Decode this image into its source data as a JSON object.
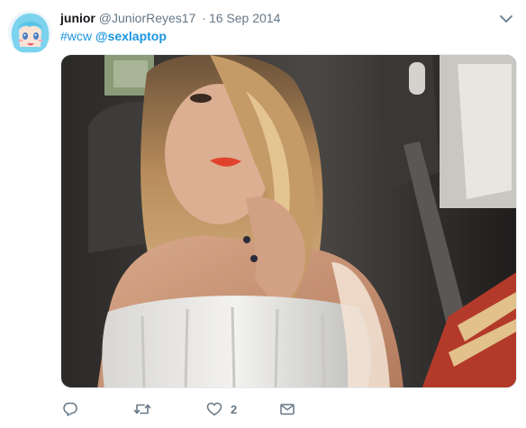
{
  "user": {
    "display_name": "junior",
    "handle": "@JuniorReyes17",
    "separator": "·",
    "date": "16 Sep 2014"
  },
  "tweet": {
    "hashtag": "#wcw",
    "mention": "@sexlaptop"
  },
  "media": {
    "alt": "Selfie of a young woman in a car seat wearing a white strapless top"
  },
  "actions": {
    "reply_count": "",
    "retweet_count": "",
    "like_count": "2"
  },
  "icons": {
    "menu": "chevron-down-icon",
    "reply": "reply-icon",
    "retweet": "retweet-icon",
    "like": "heart-icon",
    "message": "envelope-icon"
  },
  "colors": {
    "link": "#1b95e0",
    "muted": "#657786",
    "text": "#14171a"
  }
}
